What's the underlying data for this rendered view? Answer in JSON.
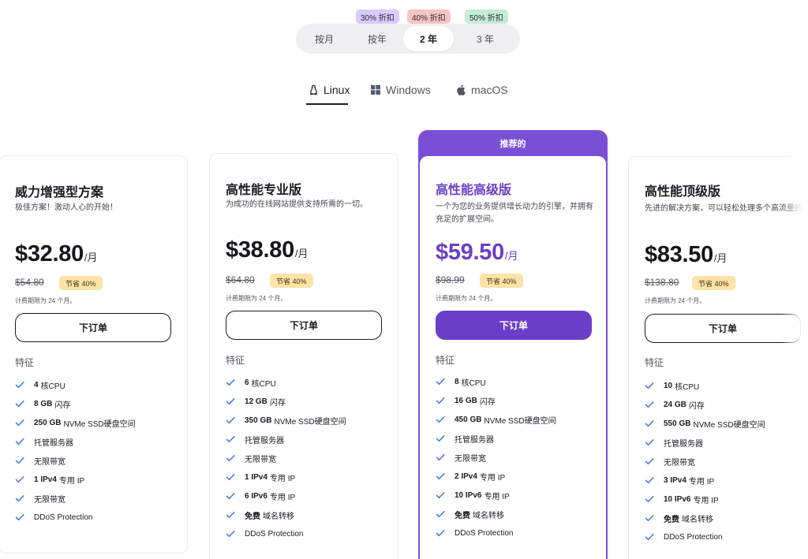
{
  "periods": {
    "items": [
      "按月",
      "按年",
      "2 年",
      "3 年"
    ],
    "active": "2 年",
    "badges": [
      "30% 折扣",
      "40% 折扣",
      "50% 折扣"
    ]
  },
  "os_tabs": {
    "items": [
      "Linux",
      "Windows",
      "macOS"
    ],
    "active": "Linux"
  },
  "recommended_label": "推荐的",
  "features_heading": "特征",
  "order_label": "下订单",
  "colors": {
    "accent": "#6a3ec9",
    "check": "#4a7bd6",
    "save_badge": "#fde3a7"
  },
  "plans": [
    {
      "title": "威力增强型方案",
      "desc": "极佳方案！激动人心的开始！",
      "price": "$32.80",
      "unit": "/月",
      "old_price": "$54.80",
      "save": "节省 40%",
      "note": "计费期限为 24 个月。",
      "features": [
        {
          "b": "4",
          "t": "核CPU"
        },
        {
          "b": "8 GB",
          "t": "闪存"
        },
        {
          "b": "250 GB",
          "t": "NVMe SSD硬盘空间"
        },
        {
          "b": "",
          "t": "托管服务器"
        },
        {
          "b": "",
          "t": "无限带宽"
        },
        {
          "b": "1 IPv4",
          "t": "专用 IP"
        },
        {
          "b": "",
          "t": "无限带宽"
        },
        {
          "b": "",
          "t": "DDoS Protection"
        }
      ]
    },
    {
      "title": "高性能专业版",
      "desc": "为成功的在线网站提供支持所需的一切。",
      "price": "$38.80",
      "unit": "/月",
      "old_price": "$64.80",
      "save": "节省 40%",
      "note": "计费期限为 24 个月。",
      "features": [
        {
          "b": "6",
          "t": "核CPU"
        },
        {
          "b": "12 GB",
          "t": "闪存"
        },
        {
          "b": "350 GB",
          "t": "NVMe SSD硬盘空间"
        },
        {
          "b": "",
          "t": "托管服务器"
        },
        {
          "b": "",
          "t": "无限带宽"
        },
        {
          "b": "1 IPv4",
          "t": "专用 IP"
        },
        {
          "b": "6 IPv6",
          "t": "专用 IP"
        },
        {
          "b": "免费",
          "t": "域名转移"
        },
        {
          "b": "",
          "t": "DDoS Protection"
        }
      ]
    },
    {
      "title": "高性能高级版",
      "desc": "一个为您的业务提供增长动力的引擎，并拥有充足的扩展空间。",
      "price": "$59.50",
      "unit": "/月",
      "old_price": "$98.99",
      "save": "节省 40%",
      "note": "计费期限为 24 个月。",
      "features": [
        {
          "b": "8",
          "t": "核CPU"
        },
        {
          "b": "16 GB",
          "t": "闪存"
        },
        {
          "b": "450 GB",
          "t": "NVMe SSD硬盘空间"
        },
        {
          "b": "",
          "t": "托管服务器"
        },
        {
          "b": "",
          "t": "无限带宽"
        },
        {
          "b": "2 IPv4",
          "t": "专用 IP"
        },
        {
          "b": "10 IPv6",
          "t": "专用 IP"
        },
        {
          "b": "免费",
          "t": "域名转移"
        },
        {
          "b": "",
          "t": "DDoS Protection"
        }
      ]
    },
    {
      "title": "高性能顶级版",
      "desc": "先进的解决方案，可以轻松处理多个高流量的网站。",
      "price": "$83.50",
      "unit": "/月",
      "old_price": "$138.80",
      "save": "节省 40%",
      "note": "计费期限为 24 个月。",
      "features": [
        {
          "b": "10",
          "t": "核CPU"
        },
        {
          "b": "24 GB",
          "t": "闪存"
        },
        {
          "b": "550 GB",
          "t": "NVMe SSD硬盘空间"
        },
        {
          "b": "",
          "t": "托管服务器"
        },
        {
          "b": "",
          "t": "无限带宽"
        },
        {
          "b": "3 IPv4",
          "t": "专用 IP"
        },
        {
          "b": "10 IPv6",
          "t": "专用 IP"
        },
        {
          "b": "免费",
          "t": "域名转移"
        },
        {
          "b": "",
          "t": "DDoS Protection"
        }
      ]
    }
  ]
}
